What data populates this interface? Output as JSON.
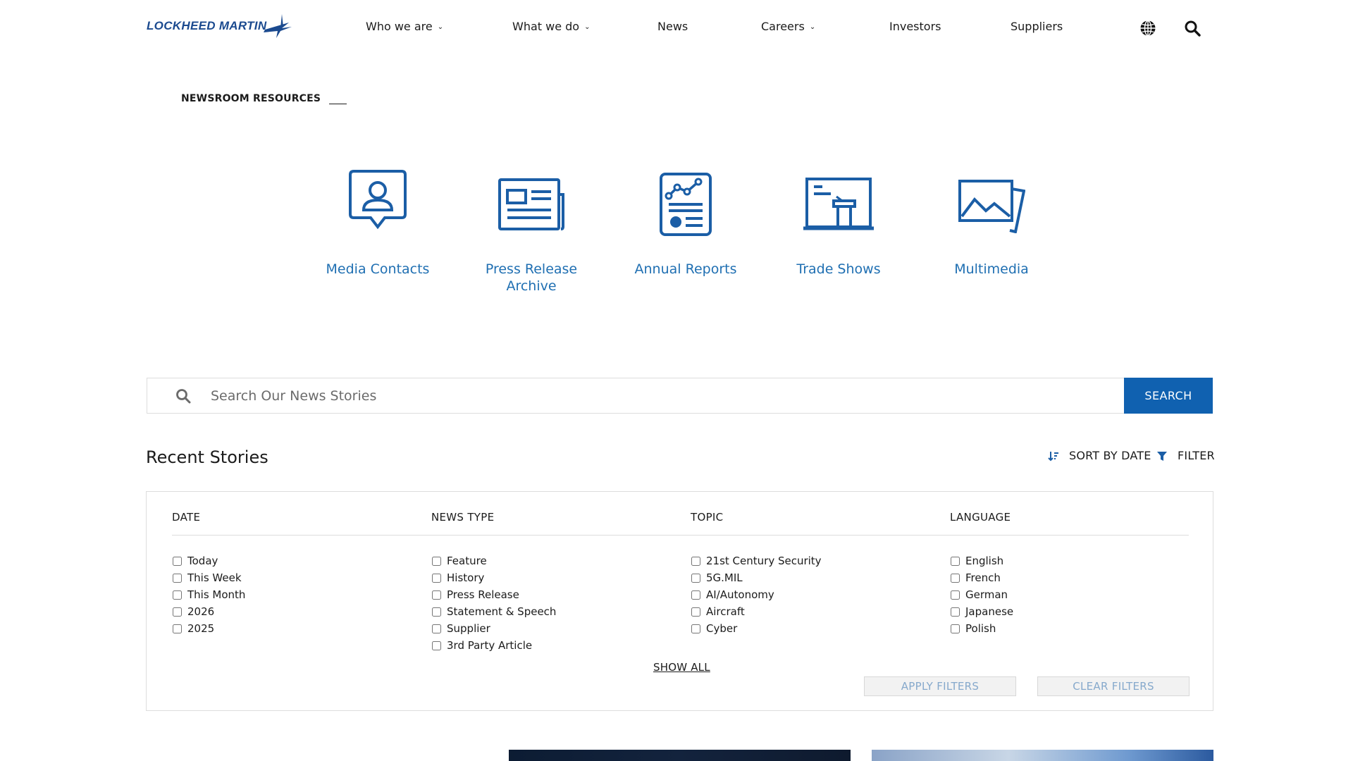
{
  "header": {
    "logo_text": "LOCKHEED MARTIN",
    "nav": [
      {
        "label": "Who we are",
        "caret": true
      },
      {
        "label": "What we do",
        "caret": true
      },
      {
        "label": "News",
        "caret": false
      },
      {
        "label": "Careers",
        "caret": true
      },
      {
        "label": "Investors",
        "caret": false
      },
      {
        "label": "Suppliers",
        "caret": false
      }
    ],
    "icons": [
      "globe-icon",
      "search-icon"
    ]
  },
  "resources": {
    "title": "NEWSROOM RESOURCES",
    "items": [
      {
        "label": "Media Contacts",
        "icon": "media-contacts-icon"
      },
      {
        "label": "Press Release Archive",
        "icon": "press-release-icon"
      },
      {
        "label": "Annual Reports",
        "icon": "annual-reports-icon"
      },
      {
        "label": "Trade Shows",
        "icon": "trade-shows-icon"
      },
      {
        "label": "Multimedia",
        "icon": "multimedia-icon"
      }
    ]
  },
  "search": {
    "placeholder": "Search Our News Stories",
    "value": "",
    "button_label": "SEARCH"
  },
  "recent": {
    "title": "Recent Stories",
    "sort_label": "SORT BY DATE",
    "filter_label": "FILTER"
  },
  "filters": {
    "columns": [
      {
        "heading": "DATE",
        "options": [
          "Today",
          "This Week",
          "This Month",
          "2026",
          "2025"
        ]
      },
      {
        "heading": "NEWS TYPE",
        "options": [
          "Feature",
          "History",
          "Press Release",
          "Statement & Speech",
          "Supplier",
          "3rd Party Article"
        ]
      },
      {
        "heading": "TOPIC",
        "options": [
          "21st Century Security",
          "5G.MIL",
          "AI/Autonomy",
          "Aircraft",
          "Cyber"
        ]
      },
      {
        "heading": "LANGUAGE",
        "options": [
          "English",
          "French",
          "German",
          "Japanese",
          "Polish"
        ]
      }
    ],
    "show_all": "SHOW ALL",
    "apply_label": "APPLY FILTERS",
    "clear_label": "CLEAR FILTERS"
  },
  "colors": {
    "brand_blue": "#1061b0",
    "link_blue": "#1f6fb2",
    "icon_blue": "#1b5ea6",
    "disabled_text": "#86a9cc"
  }
}
